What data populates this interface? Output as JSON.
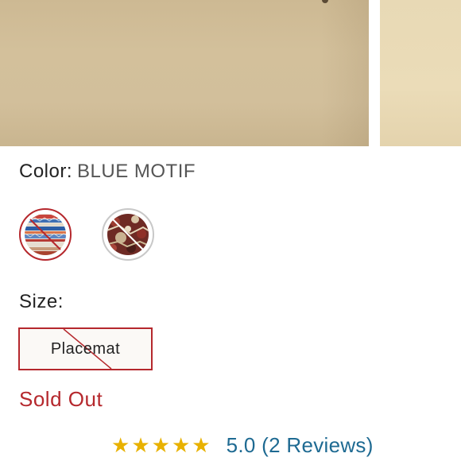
{
  "gallery": {
    "images": [
      {
        "name": "product-image-main",
        "color": "#d0bc97"
      },
      {
        "name": "product-image-next",
        "color": "#e9dab5"
      }
    ]
  },
  "color": {
    "label": "Color:",
    "value": "BLUE MOTIF",
    "swatches": [
      {
        "name": "blue-motif",
        "selected": true,
        "sold_out": true
      },
      {
        "name": "red-motif",
        "selected": false,
        "sold_out": true
      }
    ]
  },
  "size": {
    "label": "Size:",
    "options": [
      {
        "label": "Placemat",
        "selected": true,
        "sold_out": true
      }
    ]
  },
  "availability": {
    "status": "Sold Out"
  },
  "rating": {
    "stars": 5,
    "star_glyph": "★",
    "star_color": "#e8b100",
    "reviews_text": "5.0 (2 Reviews)"
  },
  "colors": {
    "accent_red": "#b5282d",
    "link_blue": "#1e6a92"
  }
}
